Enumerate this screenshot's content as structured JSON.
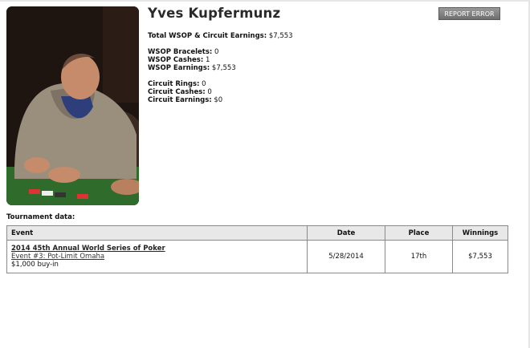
{
  "player": {
    "name": "Yves Kupfermunz"
  },
  "report_button_label": "REPORT ERROR",
  "stats": {
    "total": {
      "label": "Total WSOP & Circuit Earnings:",
      "value": "$7,553"
    },
    "bracelets": {
      "label": "WSOP Bracelets:",
      "value": "0"
    },
    "wsop_cashes": {
      "label": "WSOP Cashes:",
      "value": "1"
    },
    "wsop_earnings": {
      "label": "WSOP Earnings:",
      "value": "$7,553"
    },
    "circuit_rings": {
      "label": "Circuit Rings:",
      "value": "0"
    },
    "circuit_cashes": {
      "label": "Circuit Cashes:",
      "value": "0"
    },
    "circuit_earnings": {
      "label": "Circuit Earnings:",
      "value": "$0"
    }
  },
  "tournament": {
    "section_label": "Tournament data:",
    "columns": {
      "event": "Event",
      "date": "Date",
      "place": "Place",
      "winnings": "Winnings"
    },
    "rows": [
      {
        "series": "2014 45th Annual World Series of Poker",
        "event": "Event #3: Pot-Limit Omaha",
        "buyin": "$1,000 buy-in",
        "date": "5/28/2014",
        "place": "17th",
        "winnings": "$7,553"
      }
    ]
  }
}
